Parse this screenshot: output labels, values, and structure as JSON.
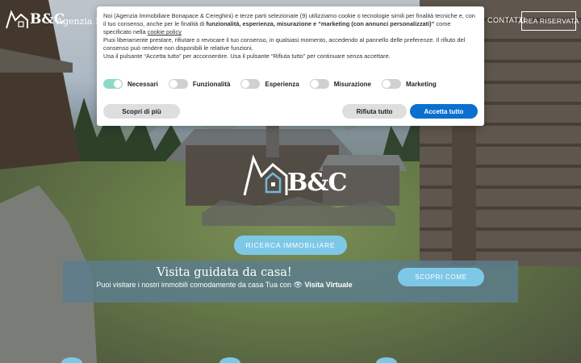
{
  "header": {
    "logo_text": "B&C",
    "agency_text": "Agenzia Imm",
    "nav_contacts": "CONTATTI",
    "nav_reserved": "AREA RISERVATA"
  },
  "cookie_banner": {
    "text_1": "Noi (Agenzia Immobiliare Bonapace & Cereghini) e terze parti selezionate (9) utilizziamo cookie o tecnologie simili per finalità tecniche e, con il tuo consenso, anche per le finalità di ",
    "text_bold": "funzionalità, esperienza, misurazione e “marketing (con annunci personalizzati)”",
    "text_2": " come specificato nella ",
    "policy_link": "cookie policy",
    "text_3": "Puoi liberamente prestare, rifiutare o revocare il tuo consenso, in qualsiasi momento, accedendo al pannello delle preferenze. Il rifiuto del consenso può rendere non disponibili le relative funzioni.",
    "text_4": "Usa il pulsante “Accetta tutto” per acconsentire. Usa il pulsante “Rifiuta tutto” per continuare senza accettare.",
    "toggles": [
      {
        "label": "Necessari",
        "on": true
      },
      {
        "label": "Funzionalità",
        "on": false
      },
      {
        "label": "Esperienza",
        "on": false
      },
      {
        "label": "Misurazione",
        "on": false
      },
      {
        "label": "Marketing",
        "on": false
      }
    ],
    "btn_more": "Scopri di più",
    "btn_reject": "Rifiuta tutto",
    "btn_accept": "Accetta tutto"
  },
  "hero": {
    "logo_text": "B&C",
    "search_button": "RICERCA IMMOBILIARE",
    "visit_title": "Visita guidata da casa!",
    "visit_sub_text": "Puoi visitare i nostri immobili comodamente da casa Tua con",
    "visit_sub_bold": "Visita Virtuale",
    "discover_button": "SCOPRI COME"
  },
  "colors": {
    "accent": "#7ec8e7",
    "accept_blue": "#0b6fcf",
    "toggle_on": "#8fd8c7"
  }
}
